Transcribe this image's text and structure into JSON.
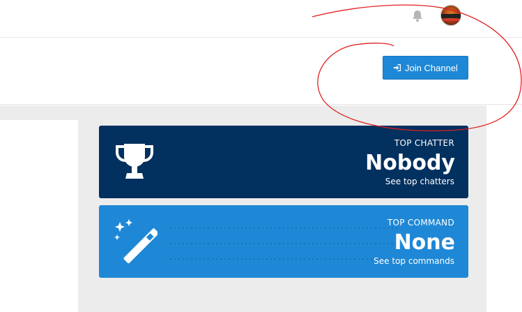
{
  "topbar": {
    "icons": {
      "bell": "bell-icon",
      "avatar": "user-avatar"
    }
  },
  "header": {
    "join_button_label": "Join Channel",
    "join_button_icon": "sign-in-icon"
  },
  "stats": {
    "top_chatter": {
      "label": "TOP CHATTER",
      "value": "Nobody",
      "link": "See top chatters",
      "icon": "trophy-icon"
    },
    "top_command": {
      "label": "TOP COMMAND",
      "value": "None",
      "link": "See top commands",
      "icon": "magic-wand-icon"
    }
  },
  "colors": {
    "accent": "#1e88d6",
    "navy": "#02305f",
    "annotation": "#e02020",
    "background": "#ececec"
  }
}
